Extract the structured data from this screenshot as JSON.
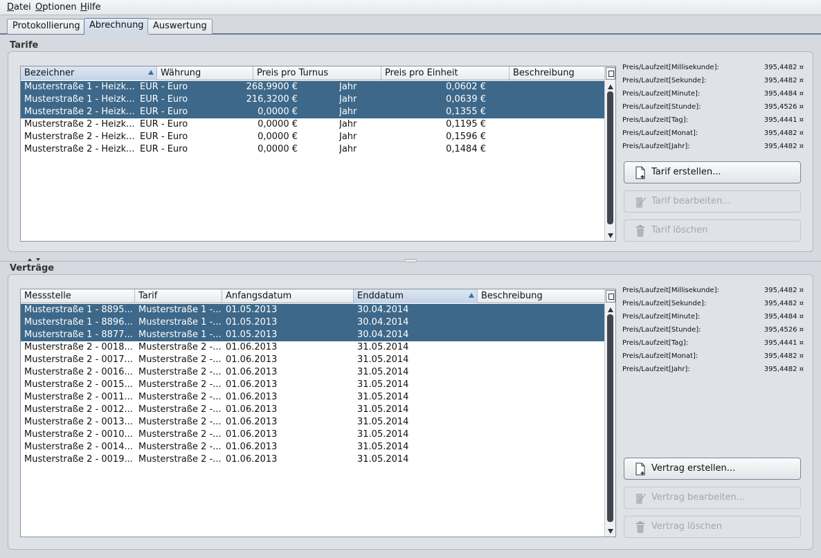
{
  "menu": [
    {
      "mnemonic": "D",
      "rest": "atei"
    },
    {
      "mnemonic": "O",
      "rest": "ptionen"
    },
    {
      "mnemonic": "H",
      "rest": "ilfe"
    }
  ],
  "tabs": [
    "Protokollierung",
    "Abrechnung",
    "Auswertung"
  ],
  "tarife": {
    "title": "Tarife",
    "columns": [
      "Bezeichner",
      "Währung",
      "Preis pro Turnus",
      "Preis pro Einheit",
      "Beschreibung"
    ],
    "rows": [
      {
        "name": "Musterstraße 1 - Heizk...",
        "currency": "EUR - Euro",
        "price": "268,9900 €",
        "turnus": "Jahr",
        "unit": "0,0602 €",
        "desc": "",
        "selected": true
      },
      {
        "name": "Musterstraße 1 - Heizk...",
        "currency": "EUR - Euro",
        "price": "216,3200 €",
        "turnus": "Jahr",
        "unit": "0,0639 €",
        "desc": "",
        "selected": true
      },
      {
        "name": "Musterstraße 2 - Heizk...",
        "currency": "EUR - Euro",
        "price": "0,0000 €",
        "turnus": "Jahr",
        "unit": "0,1355 €",
        "desc": "",
        "selected": true
      },
      {
        "name": "Musterstraße 2 - Heizk...",
        "currency": "EUR - Euro",
        "price": "0,0000 €",
        "turnus": "Jahr",
        "unit": "0,1195 €",
        "desc": "",
        "selected": false
      },
      {
        "name": "Musterstraße 2 - Heizk...",
        "currency": "EUR - Euro",
        "price": "0,0000 €",
        "turnus": "Jahr",
        "unit": "0,1596 €",
        "desc": "",
        "selected": false
      },
      {
        "name": "Musterstraße 2 - Heizk...",
        "currency": "EUR - Euro",
        "price": "0,0000 €",
        "turnus": "Jahr",
        "unit": "0,1484 €",
        "desc": "",
        "selected": false
      }
    ],
    "info": [
      {
        "label": "Preis/Laufzeit[Millisekunde]:",
        "value": "395,4482 ¤"
      },
      {
        "label": "Preis/Laufzeit[Sekunde]:",
        "value": "395,4482 ¤"
      },
      {
        "label": "Preis/Laufzeit[Minute]:",
        "value": "395,4484 ¤"
      },
      {
        "label": "Preis/Laufzeit[Stunde]:",
        "value": "395,4526 ¤"
      },
      {
        "label": "Preis/Laufzeit[Tag]:",
        "value": "395,4441 ¤"
      },
      {
        "label": "Preis/Laufzeit[Monat]:",
        "value": "395,4482 ¤"
      },
      {
        "label": "Preis/Laufzeit[Jahr]:",
        "value": "395,4482 ¤"
      }
    ],
    "buttons": {
      "create": "Tarif erstellen...",
      "edit": "Tarif bearbeiten...",
      "delete": "Tarif löschen"
    }
  },
  "vertraege": {
    "title": "Verträge",
    "columns": [
      "Messstelle",
      "Tarif",
      "Anfangsdatum",
      "Enddatum",
      "Beschreibung"
    ],
    "rows": [
      {
        "mess": "Musterstraße 1 - 8895...",
        "tarif": "Musterstraße 1 -...",
        "start": "01.05.2013",
        "end": "30.04.2014",
        "desc": "",
        "selected": true
      },
      {
        "mess": "Musterstraße 1 - 8896...",
        "tarif": "Musterstraße 1 -...",
        "start": "01.05.2013",
        "end": "30.04.2014",
        "desc": "",
        "selected": true
      },
      {
        "mess": "Musterstraße 1 - 8877...",
        "tarif": "Musterstraße 1 -...",
        "start": "01.05.2013",
        "end": "30.04.2014",
        "desc": "",
        "selected": true
      },
      {
        "mess": "Musterstraße 2 - 0018...",
        "tarif": "Musterstraße 2 -...",
        "start": "01.06.2013",
        "end": "31.05.2014",
        "desc": "",
        "selected": false
      },
      {
        "mess": "Musterstraße 2 - 0017...",
        "tarif": "Musterstraße 2 -...",
        "start": "01.06.2013",
        "end": "31.05.2014",
        "desc": "",
        "selected": false
      },
      {
        "mess": "Musterstraße 2 - 0016...",
        "tarif": "Musterstraße 2 -...",
        "start": "01.06.2013",
        "end": "31.05.2014",
        "desc": "",
        "selected": false
      },
      {
        "mess": "Musterstraße 2 - 0015...",
        "tarif": "Musterstraße 2 -...",
        "start": "01.06.2013",
        "end": "31.05.2014",
        "desc": "",
        "selected": false
      },
      {
        "mess": "Musterstraße 2 - 0011...",
        "tarif": "Musterstraße 2 -...",
        "start": "01.06.2013",
        "end": "31.05.2014",
        "desc": "",
        "selected": false
      },
      {
        "mess": "Musterstraße 2 - 0012...",
        "tarif": "Musterstraße 2 -...",
        "start": "01.06.2013",
        "end": "31.05.2014",
        "desc": "",
        "selected": false
      },
      {
        "mess": "Musterstraße 2 - 0013...",
        "tarif": "Musterstraße 2 -...",
        "start": "01.06.2013",
        "end": "31.05.2014",
        "desc": "",
        "selected": false
      },
      {
        "mess": "Musterstraße 2 - 0010...",
        "tarif": "Musterstraße 2 -...",
        "start": "01.06.2013",
        "end": "31.05.2014",
        "desc": "",
        "selected": false
      },
      {
        "mess": "Musterstraße 2 - 0014...",
        "tarif": "Musterstraße 2 -...",
        "start": "01.06.2013",
        "end": "31.05.2014",
        "desc": "",
        "selected": false
      },
      {
        "mess": "Musterstraße 2 - 0019...",
        "tarif": "Musterstraße 2 -...",
        "start": "01.06.2013",
        "end": "31.05.2014",
        "desc": "",
        "selected": false
      }
    ],
    "info": [
      {
        "label": "Preis/Laufzeit[Millisekunde]:",
        "value": "395,4482 ¤"
      },
      {
        "label": "Preis/Laufzeit[Sekunde]:",
        "value": "395,4482 ¤"
      },
      {
        "label": "Preis/Laufzeit[Minute]:",
        "value": "395,4484 ¤"
      },
      {
        "label": "Preis/Laufzeit[Stunde]:",
        "value": "395,4526 ¤"
      },
      {
        "label": "Preis/Laufzeit[Tag]:",
        "value": "395,4441 ¤"
      },
      {
        "label": "Preis/Laufzeit[Monat]:",
        "value": "395,4482 ¤"
      },
      {
        "label": "Preis/Laufzeit[Jahr]:",
        "value": "395,4482 ¤"
      }
    ],
    "buttons": {
      "create": "Vertrag erstellen...",
      "edit": "Vertrag bearbeiten...",
      "delete": "Vertrag löschen"
    }
  }
}
